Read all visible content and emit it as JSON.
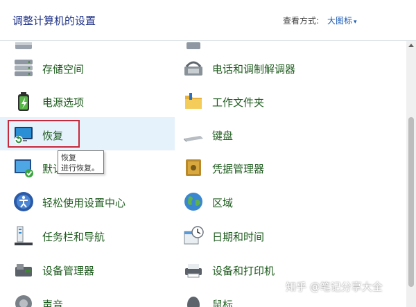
{
  "header": {
    "title": "调整计算机的设置",
    "view_by_label": "查看方式:",
    "view_by_value": "大图标"
  },
  "items_left": [
    {
      "label": "",
      "icon": "drive-icon"
    },
    {
      "label": "存储空间",
      "icon": "storage-spaces-icon"
    },
    {
      "label": "电源选项",
      "icon": "battery-icon"
    },
    {
      "label": "恢复",
      "icon": "recovery-icon"
    },
    {
      "label": "默认",
      "icon": "default-programs-icon"
    },
    {
      "label": "轻松使用设置中心",
      "icon": "ease-of-access-icon"
    },
    {
      "label": "任务栏和导航",
      "icon": "taskbar-icon"
    },
    {
      "label": "设备管理器",
      "icon": "device-manager-icon"
    },
    {
      "label": "声音",
      "icon": "speaker-icon"
    }
  ],
  "items_right": [
    {
      "label": "",
      "icon": "remote-icon"
    },
    {
      "label": "电话和调制解调器",
      "icon": "phone-modem-icon"
    },
    {
      "label": "工作文件夹",
      "icon": "folder-icon"
    },
    {
      "label": "键盘",
      "icon": "keyboard-icon"
    },
    {
      "label": "凭据管理器",
      "icon": "safe-icon"
    },
    {
      "label": "区域",
      "icon": "globe-icon"
    },
    {
      "label": "日期和时间",
      "icon": "calendar-clock-icon"
    },
    {
      "label": "设备和打印机",
      "icon": "printer-icon"
    },
    {
      "label": "鼠标",
      "icon": "mouse-icon"
    }
  ],
  "tooltip": {
    "title": "恢复",
    "desc": "进行恢复。"
  },
  "watermark": "知乎 @笔记分享大全",
  "colors": {
    "title": "#1e3287",
    "item_label": "#1f5c1f",
    "highlight": "#e5f1fb",
    "focus_box": "#c7283a",
    "link": "#1a5bb5"
  }
}
